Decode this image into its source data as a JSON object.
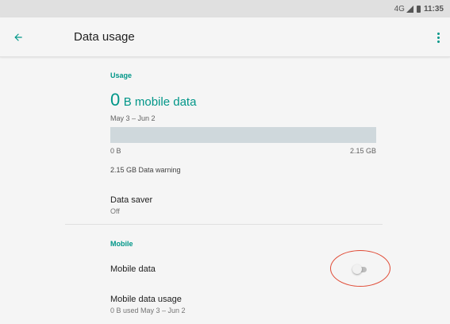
{
  "status_bar": {
    "network": "4G",
    "time": "11:35",
    "icons": [
      "signal-icon",
      "battery-icon"
    ]
  },
  "app_bar": {
    "back_icon": "arrow-back-icon",
    "title": "Data usage",
    "overflow_icon": "more-vert-icon"
  },
  "usage": {
    "section_label": "Usage",
    "amount_number": "0",
    "amount_rest": "B mobile data",
    "date_range": "May 3 – Jun 2",
    "bar_fill_fraction": 0,
    "bar_min_label": "0 B",
    "bar_max_label": "2.15 GB",
    "warning_text": "2.15 GB Data warning"
  },
  "data_saver": {
    "title": "Data saver",
    "summary": "Off"
  },
  "mobile": {
    "section_label": "Mobile",
    "mobile_data": {
      "title": "Mobile data",
      "toggle_on": false
    },
    "mobile_data_usage": {
      "title": "Mobile data usage",
      "summary": "0 B used May 3 – Jun 2"
    }
  },
  "colors": {
    "accent": "#009688",
    "highlight": "#e04a35",
    "background": "#f5f5f5"
  }
}
